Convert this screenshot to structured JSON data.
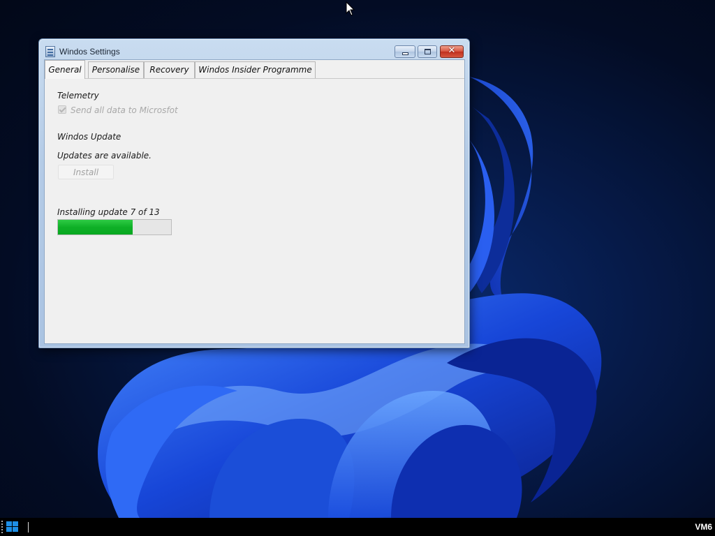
{
  "window": {
    "title": "Windos Settings",
    "close_glyph": "✕"
  },
  "tabs": [
    {
      "label": "General",
      "active": true
    },
    {
      "label": "Personalise",
      "active": false
    },
    {
      "label": "Recovery",
      "active": false
    },
    {
      "label": "Windos Insider Programme",
      "active": false
    }
  ],
  "general": {
    "telemetry_heading": "Telemetry",
    "telemetry_checkbox_label": "Send all data to Microsfot",
    "telemetry_checked": true,
    "telemetry_enabled": false,
    "update_heading": "Windos Update",
    "updates_status": "Updates are available.",
    "install_label": "Install",
    "install_enabled": false,
    "progress_label": "Installing update 7 of 13",
    "progress_fraction": 0.66
  },
  "taskbar": {
    "hostname": "VM6"
  },
  "colors": {
    "progress": "#0fb027",
    "close_button": "#c0301e",
    "start_icon": "#1e8fe6"
  }
}
